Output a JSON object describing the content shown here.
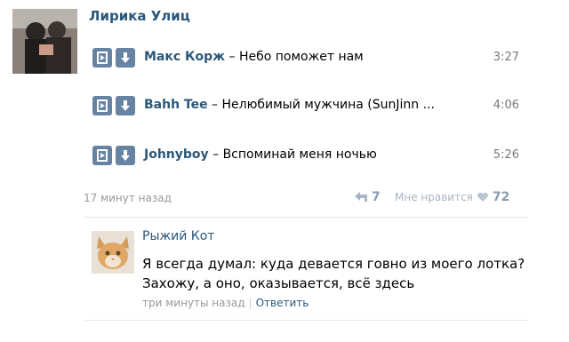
{
  "post": {
    "group_name": "Лирика Улиц",
    "time_ago": "17 минут назад",
    "reposts_count": "7",
    "likes_label": "Мне нравится",
    "likes_count": "72"
  },
  "tracks": [
    {
      "artist": "Макс Корж",
      "separator": " – ",
      "title": "Небо поможет нам",
      "duration": "3:27"
    },
    {
      "artist": "Bahh Tee",
      "separator": " – ",
      "title": "Нелюбимый мужчина (SunJinn ...",
      "duration": "4:06"
    },
    {
      "artist": "Johnyboy",
      "separator": " – ",
      "title": "Вспоминай меня ночью",
      "duration": "5:26"
    }
  ],
  "comment": {
    "author": "Рыжий Кот",
    "line1": "Я всегда думал: куда девается говно из моего лотка?",
    "line2": "Захожу, а оно, оказывается, всё здесь",
    "time": "три минуты назад",
    "separator": "|",
    "reply": "Ответить"
  },
  "colors": {
    "link": "#2b587a",
    "button": "#6783a3",
    "muted": "#999999"
  },
  "icons": [
    "play-icon",
    "download-icon",
    "repost-icon",
    "heart-icon"
  ]
}
